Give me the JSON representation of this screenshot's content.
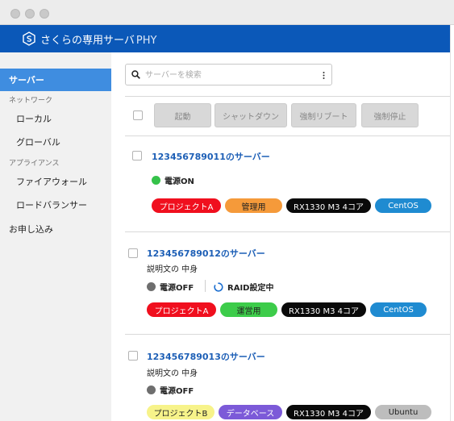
{
  "app": {
    "brand": "さくらの専用サーバ",
    "product": "PHY"
  },
  "sidebar": {
    "items": [
      {
        "label": "サーバー",
        "active": true
      },
      {
        "label": "ローカル"
      },
      {
        "label": "グローバル"
      },
      {
        "label": "ファイアウォール"
      },
      {
        "label": "ロードバランサー"
      },
      {
        "label": "お申し込み"
      }
    ],
    "sections": [
      "ネットワーク",
      "アプライアンス"
    ]
  },
  "search": {
    "placeholder": "サーバーを検索",
    "value": ""
  },
  "toolbar": {
    "buttons": [
      "起動",
      "シャットダウン",
      "強制リブート",
      "強制停止"
    ]
  },
  "servers": [
    {
      "name": "123456789011のサーバー",
      "description": "",
      "status": "電源ON",
      "status_color": "#35c24a",
      "raid": "",
      "tags": [
        {
          "label": "プロジェクトA",
          "bg": "#f00f1e",
          "fg": "#ffffff"
        },
        {
          "label": "管理用",
          "bg": "#f59a3a",
          "fg": "#222222"
        },
        {
          "label": "RX1330 M3 4コア",
          "bg": "#0a0a0a",
          "fg": "#ffffff"
        },
        {
          "label": "CentOS",
          "bg": "#1f8bd1",
          "fg": "#ffffff"
        }
      ]
    },
    {
      "name": "123456789012のサーバー",
      "description": "説明文の 中身",
      "status": "電源OFF",
      "status_color": "#6e6e6e",
      "raid": "RAID設定中",
      "tags": [
        {
          "label": "プロジェクトA",
          "bg": "#f00f1e",
          "fg": "#ffffff"
        },
        {
          "label": "運営用",
          "bg": "#3dcc4a",
          "fg": "#222222"
        },
        {
          "label": "RX1330 M3 4コア",
          "bg": "#0a0a0a",
          "fg": "#ffffff"
        },
        {
          "label": "CentOS",
          "bg": "#1f8bd1",
          "fg": "#ffffff"
        }
      ]
    },
    {
      "name": "123456789013のサーバー",
      "description": "説明文の 中身",
      "status": "電源OFF",
      "status_color": "#6e6e6e",
      "raid": "",
      "tags": [
        {
          "label": "プロジェクトB",
          "bg": "#f7f38a",
          "fg": "#222222"
        },
        {
          "label": "データベース",
          "bg": "#7c5ad8",
          "fg": "#ffffff"
        },
        {
          "label": "RX1330 M3 4コア",
          "bg": "#0a0a0a",
          "fg": "#ffffff"
        },
        {
          "label": "Ubuntu",
          "bg": "#bdbdbd",
          "fg": "#222222"
        }
      ]
    }
  ],
  "colors": {
    "header": "#0b58b8",
    "active_nav": "#3f8de0",
    "link": "#1d5fb6"
  }
}
